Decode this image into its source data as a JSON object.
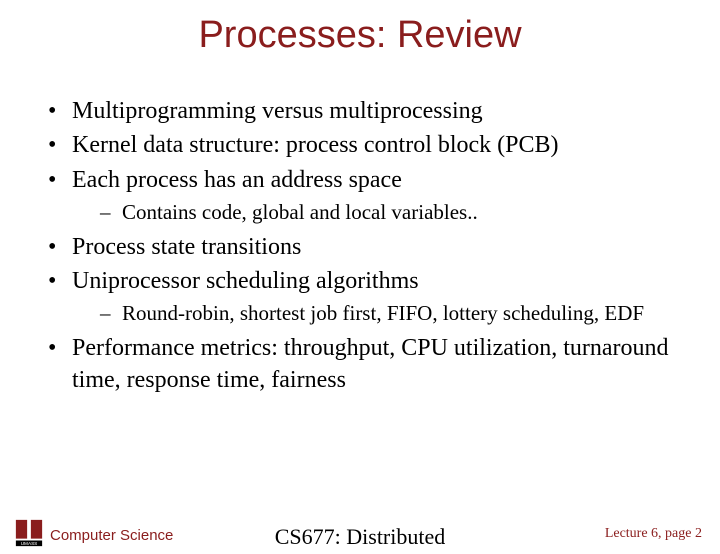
{
  "title": "Processes: Review",
  "bullets": [
    {
      "text": "Multiprogramming versus multiprocessing"
    },
    {
      "text": "Kernel data structure: process control block (PCB)"
    },
    {
      "text": "Each process has an address space",
      "sub": [
        "Contains code, global and local variables.."
      ]
    },
    {
      "text": "Process state transitions"
    },
    {
      "text": "Uniprocessor scheduling algorithms",
      "sub": [
        "Round-robin, shortest job first, FIFO, lottery scheduling, EDF"
      ]
    },
    {
      "text": "Performance metrics: throughput, CPU utilization, turnaround time, response time, fairness"
    }
  ],
  "footer": {
    "department": "Computer Science",
    "course": "CS677: Distributed",
    "page_label": "Lecture 6, page 2"
  },
  "colors": {
    "accent": "#8a1d1d"
  }
}
